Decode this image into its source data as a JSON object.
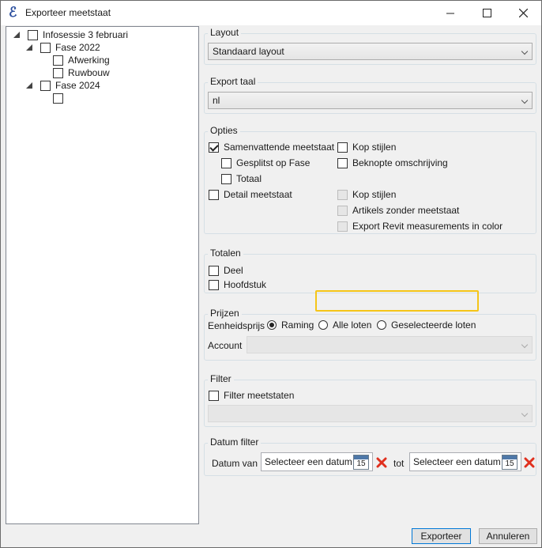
{
  "window": {
    "title": "Exporteer meetstaat"
  },
  "tree": {
    "items": [
      {
        "label": "Infosessie 3 februari",
        "checked": false
      },
      {
        "label": "Fase 2022",
        "checked": false
      },
      {
        "label": "Afwerking",
        "checked": false
      },
      {
        "label": "Ruwbouw",
        "checked": false
      },
      {
        "label": "Fase 2024",
        "checked": false
      },
      {
        "label": "",
        "checked": false
      }
    ]
  },
  "layout": {
    "title": "Layout",
    "value": "Standaard layout"
  },
  "export_taal": {
    "title": "Export taal",
    "value": "nl"
  },
  "opties": {
    "title": "Opties",
    "samenvattende": "Samenvattende meetstaat",
    "gesplitst": "Gesplitst op Fase",
    "totaal": "Totaal",
    "detail": "Detail meetstaat",
    "kop_stijlen_1": "Kop stijlen",
    "beknopte": "Beknopte omschrijving",
    "kop_stijlen_2": "Kop stijlen",
    "artikels": "Artikels zonder meetstaat",
    "export_revit": "Export Revit measurements in color"
  },
  "totalen": {
    "title": "Totalen",
    "deel": "Deel",
    "hoofdstuk": "Hoofdstuk"
  },
  "prijzen": {
    "title": "Prijzen",
    "eenheidsprijs": "Eenheidsprijs",
    "raming": "Raming",
    "alle_loten": "Alle loten",
    "geselecteerde_loten": "Geselecteerde loten",
    "account": "Account",
    "account_value": ""
  },
  "filter": {
    "title": "Filter",
    "filter_meetstaten": "Filter meetstaten",
    "value": ""
  },
  "datum_filter": {
    "title": "Datum filter",
    "van": "Datum van",
    "tot": "tot",
    "placeholder_from": "Selecteer een datum",
    "placeholder_to": "Selecteer een datum",
    "calendar_day": "15"
  },
  "buttons": {
    "export": "Exporteer",
    "cancel": "Annuleren"
  }
}
